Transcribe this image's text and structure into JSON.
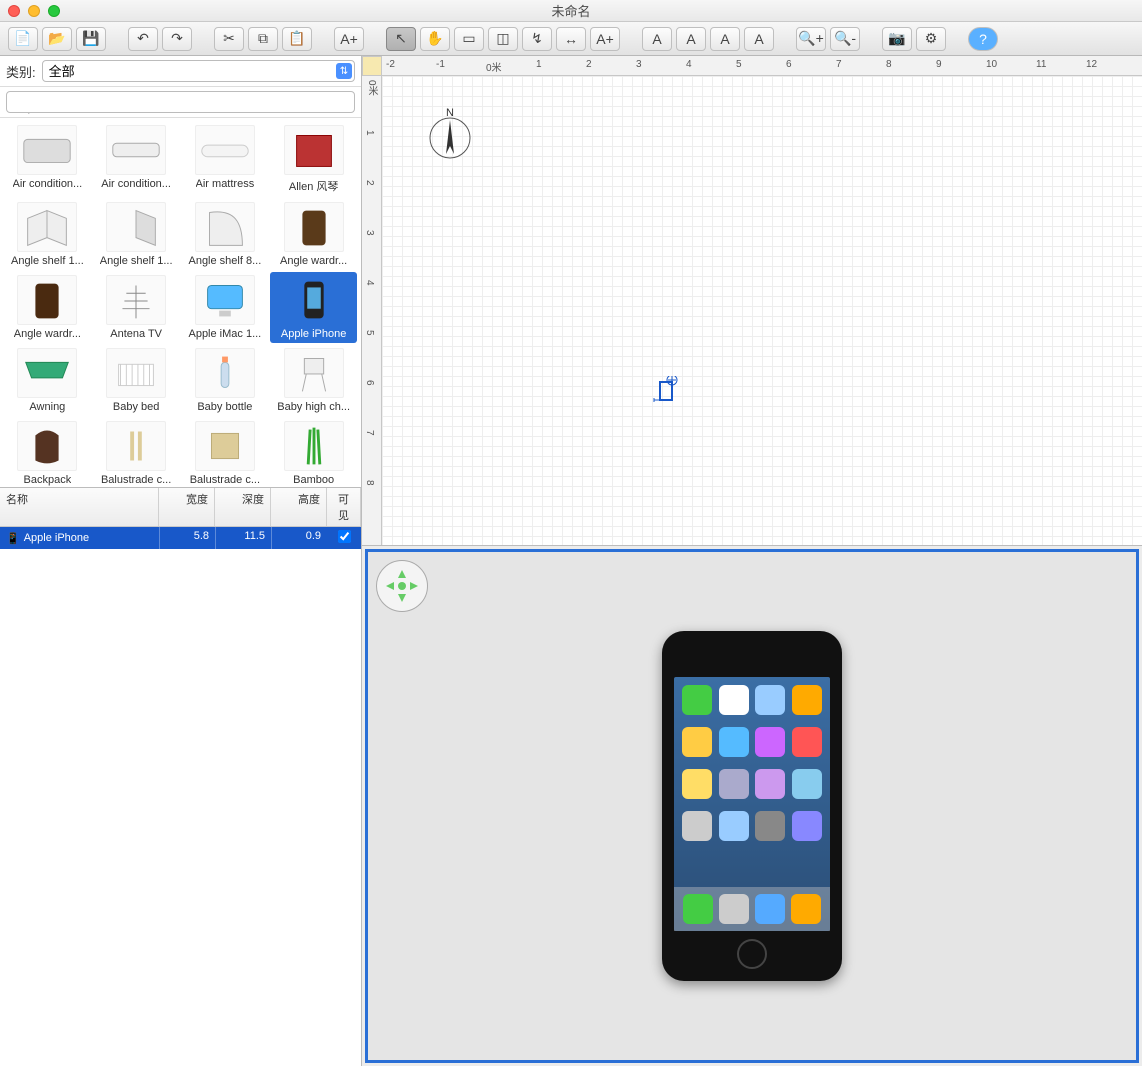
{
  "window": {
    "title": "未命名"
  },
  "toolbar": {
    "groups": [
      [
        "new",
        "open",
        "save"
      ],
      [
        "undo",
        "redo"
      ],
      [
        "cut",
        "copy",
        "paste"
      ],
      [
        "add-furniture"
      ],
      [
        "select",
        "pan",
        "create-walls",
        "create-rooms",
        "create-polyline",
        "create-dimension",
        "add-text"
      ],
      [
        "text-bigger",
        "text-smaller",
        "bold",
        "italic"
      ],
      [
        "zoom-in",
        "zoom-out"
      ],
      [
        "snapshot",
        "preferences"
      ],
      [
        "help"
      ]
    ],
    "active": "select"
  },
  "sidebar": {
    "category_label": "类别:",
    "category_value": "全部",
    "search_placeholder": "",
    "items": [
      {
        "label": "Air condition...",
        "icon": "ac-unit"
      },
      {
        "label": "Air condition...",
        "icon": "ac-wall"
      },
      {
        "label": "Air mattress",
        "icon": "mattress"
      },
      {
        "label": "Allen 风琴",
        "icon": "organ"
      },
      {
        "label": "Angle shelf 1...",
        "icon": "shelf"
      },
      {
        "label": "Angle shelf 1...",
        "icon": "shelf2"
      },
      {
        "label": "Angle shelf 8...",
        "icon": "shelf3"
      },
      {
        "label": "Angle wardr...",
        "icon": "wardrobe"
      },
      {
        "label": "Angle wardr...",
        "icon": "wardrobe2"
      },
      {
        "label": "Antena TV",
        "icon": "antenna"
      },
      {
        "label": "Apple iMac 1...",
        "icon": "imac"
      },
      {
        "label": "Apple iPhone",
        "icon": "iphone",
        "selected": true
      },
      {
        "label": "Awning",
        "icon": "awning"
      },
      {
        "label": "Baby bed",
        "icon": "crib"
      },
      {
        "label": "Baby bottle",
        "icon": "bottle"
      },
      {
        "label": "Baby high ch...",
        "icon": "highchair"
      },
      {
        "label": "Backpack",
        "icon": "backpack"
      },
      {
        "label": "Balustrade c...",
        "icon": "balustrade"
      },
      {
        "label": "Balustrade c...",
        "icon": "balustrade2"
      },
      {
        "label": "Bamboo",
        "icon": "bamboo"
      }
    ]
  },
  "furniture_table": {
    "headers": {
      "name": "名称",
      "width": "宽度",
      "depth": "深度",
      "height": "高度",
      "visible": "可见"
    },
    "rows": [
      {
        "name": "Apple iPhone",
        "width": "5.8",
        "depth": "11.5",
        "height": "0.9",
        "visible": true
      }
    ]
  },
  "plan": {
    "h_ticks": [
      "-2",
      "-1",
      "0米",
      "1",
      "2",
      "3",
      "4",
      "5",
      "6",
      "7",
      "8",
      "9",
      "10",
      "11",
      "12"
    ],
    "v_ticks": [
      "0米",
      "1",
      "2",
      "3",
      "4",
      "5",
      "6",
      "7",
      "8"
    ],
    "compass_label": "N"
  },
  "view3d": {
    "selected_object": "Apple iPhone"
  }
}
